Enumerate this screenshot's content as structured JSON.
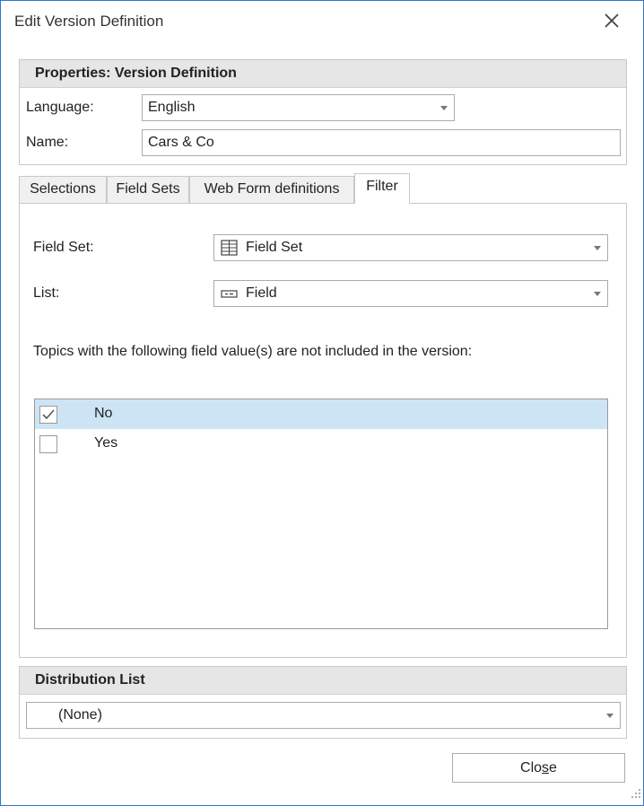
{
  "window": {
    "title": "Edit Version Definition",
    "close_icon": "close-icon"
  },
  "properties": {
    "header": "Properties: Version Definition",
    "language_label": "Language:",
    "language_value": "English",
    "name_label": "Name:",
    "name_value": "Cars & Co"
  },
  "tabs": [
    {
      "label": "Selections",
      "active": false
    },
    {
      "label": "Field Sets",
      "active": false
    },
    {
      "label": "Web Form definitions",
      "active": false
    },
    {
      "label": "Filter",
      "active": true
    }
  ],
  "filter": {
    "field_set_label": "Field Set:",
    "field_set_value": "Field Set",
    "field_set_icon": "field-set-icon",
    "list_label": "List:",
    "list_value": "Field",
    "list_icon": "field-icon",
    "description": "Topics with the following field value(s) are not included in the version:",
    "items": [
      {
        "label": "No",
        "checked": true,
        "selected": true
      },
      {
        "label": "Yes",
        "checked": false,
        "selected": false
      }
    ]
  },
  "distribution": {
    "header": "Distribution List",
    "value": "(None)"
  },
  "footer": {
    "close_label": "Close",
    "close_accesskey": "s"
  },
  "colors": {
    "window_border": "#2b79d0",
    "selected_row": "#cde4f5",
    "group_header": "#e6e6e6"
  }
}
